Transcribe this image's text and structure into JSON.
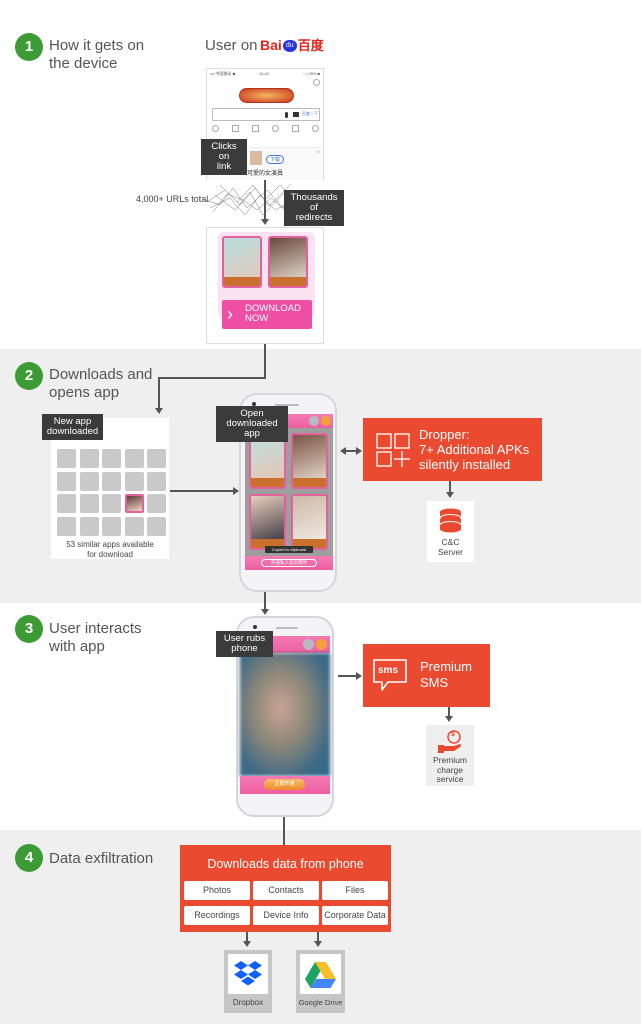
{
  "steps": [
    {
      "number": "1",
      "title_line1": "How it gets on",
      "title_line2": "the device"
    },
    {
      "number": "2",
      "title_line1": "Downloads and",
      "title_line2": "opens app"
    },
    {
      "number": "3",
      "title_line1": "User interacts",
      "title_line2": "with app"
    },
    {
      "number": "4",
      "title_line1": "Data exfiltration",
      "title_line2": ""
    }
  ],
  "step1": {
    "user_on_label": "User on",
    "baidu_logo_text_latin": "Bai",
    "baidu_logo_paw_text": "du",
    "baidu_logo_text_cjk": "百度",
    "browser": {
      "status_left": "••• 中国移动 ◆",
      "status_time": "14:42",
      "status_right": "↑ • 39% ■",
      "search_button": "百度一下",
      "ad_download_button": "下载",
      "ad_caption": "可愛的女演員",
      "ad_close": "×"
    },
    "clicks_tag_line1": "Clicks on",
    "clicks_tag_line2": "link",
    "urls_label": "4,000+ URLs total",
    "redirects_tag_line1": "Thousands of",
    "redirects_tag_line2": "redirects",
    "landing": {
      "download_line1": "DOWNLOAD",
      "download_line2": "NOW",
      "download_chevron": "›"
    }
  },
  "step2": {
    "new_app_tag_line1": "New app",
    "new_app_tag_line2": "downloaded",
    "apps_caption_line1": "53 similar apps available",
    "apps_caption_line2": "for download",
    "open_tag_line1": "Open",
    "open_tag_line2": "downloaded app",
    "toast": "Copied to clipboard",
    "app_footer_button": "开通私人会员限时",
    "dropper_line1": "Dropper:",
    "dropper_line2": "7+ Additional APKs",
    "dropper_line3": "silently installed",
    "cc_line1": "C&C",
    "cc_line2": "Server"
  },
  "step3": {
    "rubs_tag_line1": "User rubs",
    "rubs_tag_line2": "phone",
    "app_button": "立即开通",
    "sms_icon_text": "sms",
    "sms_line1": "Premium",
    "sms_line2": "SMS",
    "charge_line1": "Premium",
    "charge_line2": "charge",
    "charge_line3": "service",
    "charge_icon_symbol": "$"
  },
  "step4": {
    "box_title": "Downloads data from phone",
    "items": [
      "Photos",
      "Contacts",
      "Files",
      "Recordings",
      "Device Info",
      "Corporate Data"
    ],
    "destinations": [
      {
        "label": "Dropbox",
        "icon": "dropbox-icon"
      },
      {
        "label": "Google Drive",
        "icon": "google-drive-icon"
      }
    ]
  },
  "colors": {
    "step_badge": "#3d9b35",
    "accent_red": "#ea4a2f",
    "app_pink": "#ee5ea2",
    "band_gray": "#efefef",
    "tag_dark": "#3b3b3b"
  }
}
